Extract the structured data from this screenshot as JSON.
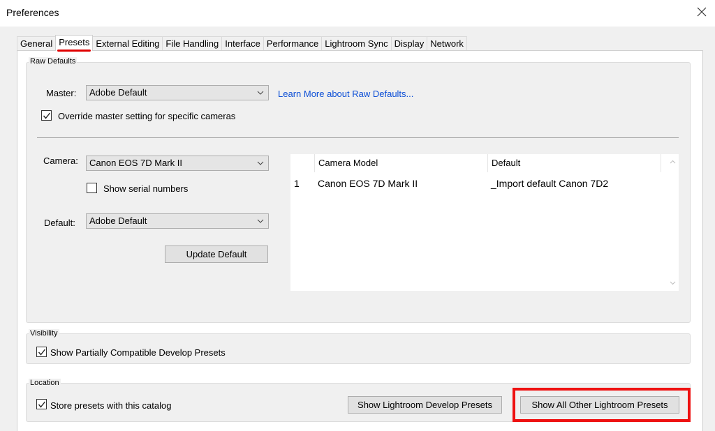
{
  "window": {
    "title": "Preferences"
  },
  "tabs": [
    "General",
    "Presets",
    "External Editing",
    "File Handling",
    "Interface",
    "Performance",
    "Lightroom Sync",
    "Display",
    "Network"
  ],
  "active_tab": "Presets",
  "raw_defaults": {
    "group_title": "Raw Defaults",
    "master_label": "Master:",
    "master_value": "Adobe Default",
    "learn_more_link": "Learn More about Raw Defaults...",
    "override_label": "Override master setting for specific cameras",
    "override_checked": true,
    "camera_label": "Camera:",
    "camera_value": "Canon EOS 7D Mark II",
    "show_serial_label": "Show serial numbers",
    "show_serial_checked": false,
    "default_label": "Default:",
    "default_value": "Adobe Default",
    "update_default_button": "Update Default",
    "table": {
      "columns": [
        "",
        "Camera Model",
        "Default"
      ],
      "rows": [
        {
          "index": "1",
          "camera_model": "Canon EOS 7D Mark II",
          "default": "_Import default Canon 7D2"
        }
      ]
    }
  },
  "visibility": {
    "group_title": "Visibility",
    "show_partial_label": "Show Partially Compatible Develop Presets",
    "show_partial_checked": true
  },
  "location": {
    "group_title": "Location",
    "store_presets_label": "Store presets with this catalog",
    "store_presets_checked": true,
    "show_develop_presets_button": "Show Lightroom Develop Presets",
    "show_all_other_button": "Show All Other Lightroom Presets"
  },
  "colors": {
    "highlight": "#ee1111",
    "link": "#0d4fd6",
    "tab_underline": "#e00000"
  },
  "icons": {
    "close": "close-icon",
    "dropdown": "chevron-down-icon",
    "check": "checkmark-icon"
  }
}
